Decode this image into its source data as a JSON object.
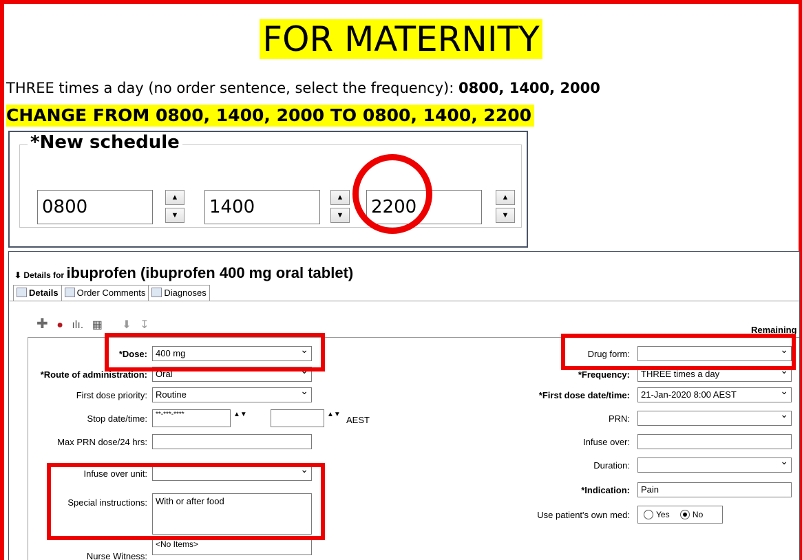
{
  "header": {
    "title": "FOR MATERNITY",
    "instruction_text": "THREE times a day (no order sentence, select the frequency): ",
    "instruction_times": "0800, 1400, 2000",
    "change_text": "CHANGE FROM 0800, 1400, 2000 TO 0800, 1400, 2200"
  },
  "schedule": {
    "legend": "*New schedule",
    "times": [
      "0800",
      "1400",
      "2200"
    ]
  },
  "details": {
    "prefix": "Details for",
    "drug": "ibuprofen (ibuprofen 400 mg oral tablet)",
    "tabs": [
      "Details",
      "Order Comments",
      "Diagnoses"
    ],
    "remaining": "Remaining"
  },
  "form": {
    "dose_label": "*Dose:",
    "dose_value": "400 mg",
    "route_label": "*Route of administration:",
    "route_value": "Oral",
    "first_priority_label": "First dose priority:",
    "first_priority_value": "Routine",
    "stop_label": "Stop date/time:",
    "stop_value": "**-***-****",
    "stop_tz": "AEST",
    "max_prn_label": "Max PRN dose/24 hrs:",
    "infuse_unit_label": "Infuse over unit:",
    "special_label": "Special instructions:",
    "special_value": "With or after food",
    "nurse_label": "Nurse Witness:",
    "nurse_value": "<No Items>",
    "drug_form_label": "Drug form:",
    "frequency_label": "*Frequency:",
    "frequency_value": "THREE times a day",
    "first_dose_label": "*First dose date/time:",
    "first_dose_value": "21-Jan-2020 8:00 AEST",
    "prn_label": "PRN:",
    "infuse_over_label": "Infuse over:",
    "duration_label": "Duration:",
    "indication_label": "*Indication:",
    "indication_value": "Pain",
    "own_med_label": "Use patient's own med:",
    "own_med_yes": "Yes",
    "own_med_no": "No"
  },
  "colors": {
    "highlight": "#ffff00",
    "annotation_red": "#ee0000"
  }
}
